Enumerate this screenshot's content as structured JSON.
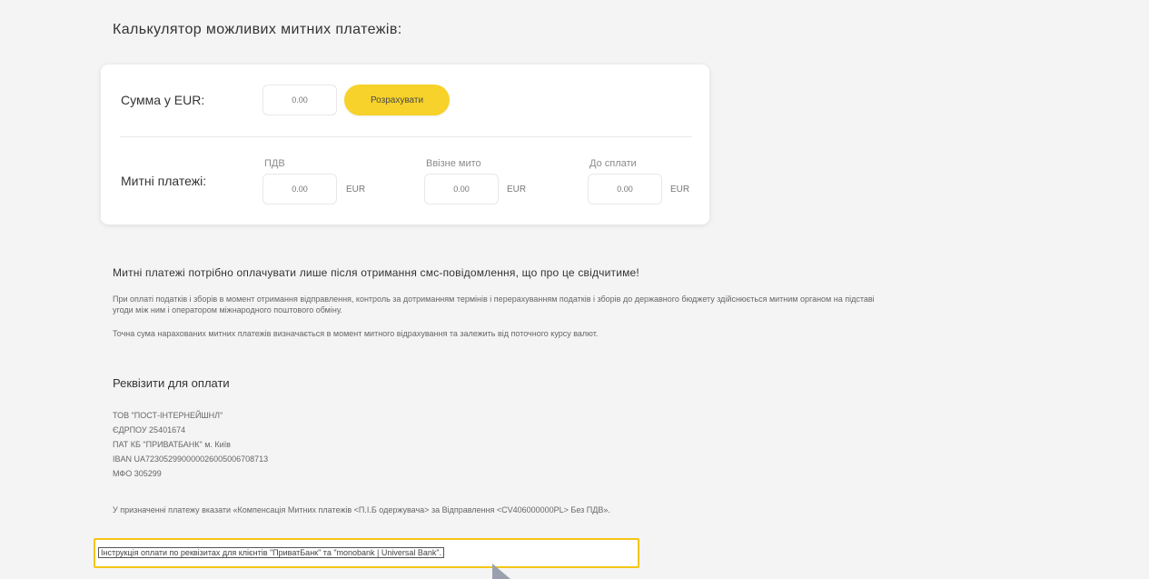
{
  "calculator": {
    "title": "Калькулятор можливих митних платежів:",
    "amount_label": "Сумма у EUR:",
    "amount_placeholder": "0.00",
    "calculate_button": "Розрахувати",
    "payments_label": "Митні платежі:",
    "vat": {
      "header": "ПДВ",
      "value": "0.00",
      "unit": "EUR"
    },
    "duty": {
      "header": "Ввізне мито",
      "value": "0.00",
      "unit": "EUR"
    },
    "total": {
      "header": "До сплати",
      "value": "0.00",
      "unit": "EUR"
    }
  },
  "info": {
    "warning": "Митні платежі потрібно оплачувати лише після отримання смс-повідомлення, що про це свідчитиме!",
    "paragraph1_line1": "При оплаті податків і зборів в момент отримання відправлення, контроль за дотриманням термінів і перерахуванням податків і зборів до державного бюджету здійснюється митним органом на підставі",
    "paragraph1_line2": "угоди між ним і оператором міжнародного поштового обміну.",
    "paragraph2": "Точна сума нарахованих митних платежів визначається в момент митного відрахування та залежить від поточного курсу валют."
  },
  "requisites": {
    "title": "Реквізити для оплати",
    "lines": [
      "ТОВ \"ПОСТ-ІНТЕРНЕЙШНЛ\"",
      "ЄДРПОУ 25401674",
      "ПАТ КБ \"ПРИВАТБАНК\" м. Київ",
      "IBAN UA723052990000026005006708713",
      "МФО 305299"
    ],
    "purpose_note": "У призначенні платежу вказати «Компенсація Митних платежів <П.І.Б одержувача> за Відправлення <CV406000000PL> Без ПДВ».",
    "instruction_link": "Інструкція оплати по реквізитах для клієнтів \"ПриватБанк\" та \"monobank | Universal Bank\"."
  },
  "colors": {
    "accent": "#f6d22a",
    "highlight_border": "#f5c518",
    "background": "#f4f4f4"
  }
}
